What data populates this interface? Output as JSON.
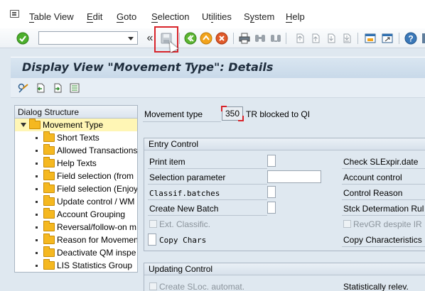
{
  "menu": {
    "items": [
      "Table View",
      "Edit",
      "Goto",
      "Selection",
      "Utilities",
      "System",
      "Help"
    ],
    "underline": [
      "T",
      "E",
      "G",
      "S",
      "i",
      "y",
      "H"
    ]
  },
  "toolbar": {
    "command_field_value": "",
    "collapse_glyph": "«",
    "icons": [
      "enter-icon",
      "command-dropdown-icon",
      "save-icon",
      "back-icon",
      "exit-icon",
      "cancel-icon",
      "print-icon",
      "find-icon",
      "find-next-icon",
      "first-page-icon",
      "previous-page-icon",
      "next-page-icon",
      "last-page-icon",
      "create-session-icon",
      "create-shortcut-icon",
      "help-icon",
      "customize-layout-icon"
    ]
  },
  "title": "Display View \"Movement Type\": Details",
  "dialog_structure": {
    "header": "Dialog Structure",
    "items": [
      {
        "label": "Movement Type",
        "selected": true,
        "expanded": true
      },
      {
        "label": "Short Texts"
      },
      {
        "label": "Allowed Transactions"
      },
      {
        "label": "Help Texts"
      },
      {
        "label": "Field selection (from"
      },
      {
        "label": "Field selection (Enjoy"
      },
      {
        "label": "Update control / WM"
      },
      {
        "label": "Account Grouping"
      },
      {
        "label": "Reversal/follow-on m"
      },
      {
        "label": "Reason for Movemen"
      },
      {
        "label": "Deactivate QM inspe"
      },
      {
        "label": "LIS Statistics Group"
      }
    ]
  },
  "movement_type": {
    "label": "Movement type",
    "value": "350",
    "description": "TR blocked to QI"
  },
  "entry_control": {
    "header": "Entry Control",
    "left": [
      "Print item",
      "Selection parameter",
      "Classif.batches",
      "Create New Batch",
      "Ext. Classific.",
      "Copy Chars"
    ],
    "right": [
      "Check SLExpir.date",
      "Account control",
      "Control Reason",
      "Stck Determation Rul",
      "RevGR despite IR",
      "Copy Characteristics"
    ]
  },
  "updating_control": {
    "header": "Updating Control",
    "left": [
      "Create SLoc. automat."
    ],
    "right": [
      "Statistically relev."
    ]
  },
  "colors": {
    "highlight": "#d8232a",
    "selected_row": "#fff6b5",
    "folder": "#f5b820"
  }
}
